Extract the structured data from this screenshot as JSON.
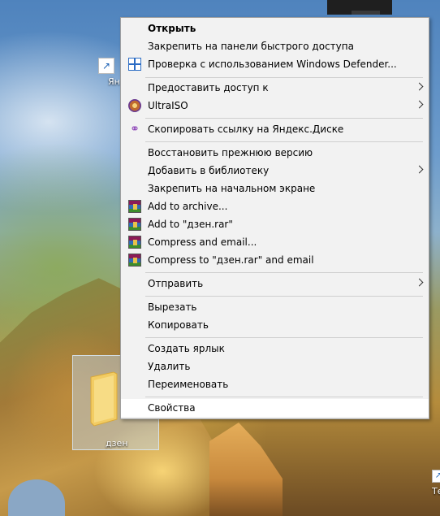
{
  "desktop": {
    "icons": [
      {
        "label": "Ян"
      },
      {
        "label": "дзен"
      },
      {
        "label": "Те"
      }
    ]
  },
  "context_menu": {
    "items": [
      {
        "label": "Открыть",
        "bold": true
      },
      {
        "label": "Закрепить на панели быстрого доступа"
      },
      {
        "label": "Проверка с использованием Windows Defender...",
        "icon": "windows-defender-icon"
      },
      {
        "label": "Предоставить доступ к",
        "submenu": true
      },
      {
        "label": "UltraISO",
        "icon": "ultraiso-icon",
        "submenu": true
      },
      {
        "label": "Скопировать ссылку на Яндекс.Диске",
        "icon": "yandex-disk-link-icon"
      },
      {
        "label": "Восстановить прежнюю версию"
      },
      {
        "label": "Добавить в библиотеку",
        "submenu": true
      },
      {
        "label": "Закрепить на начальном экране"
      },
      {
        "label": "Add to archive...",
        "icon": "winrar-icon"
      },
      {
        "label": "Add to \"дзен.rar\"",
        "icon": "winrar-icon"
      },
      {
        "label": "Compress and email...",
        "icon": "winrar-icon"
      },
      {
        "label": "Compress to \"дзен.rar\" and email",
        "icon": "winrar-icon"
      },
      {
        "label": "Отправить",
        "submenu": true
      },
      {
        "label": "Вырезать"
      },
      {
        "label": "Копировать"
      },
      {
        "label": "Создать ярлык"
      },
      {
        "label": "Удалить"
      },
      {
        "label": "Переименовать"
      },
      {
        "label": "Свойства",
        "highlighted": true
      }
    ]
  }
}
